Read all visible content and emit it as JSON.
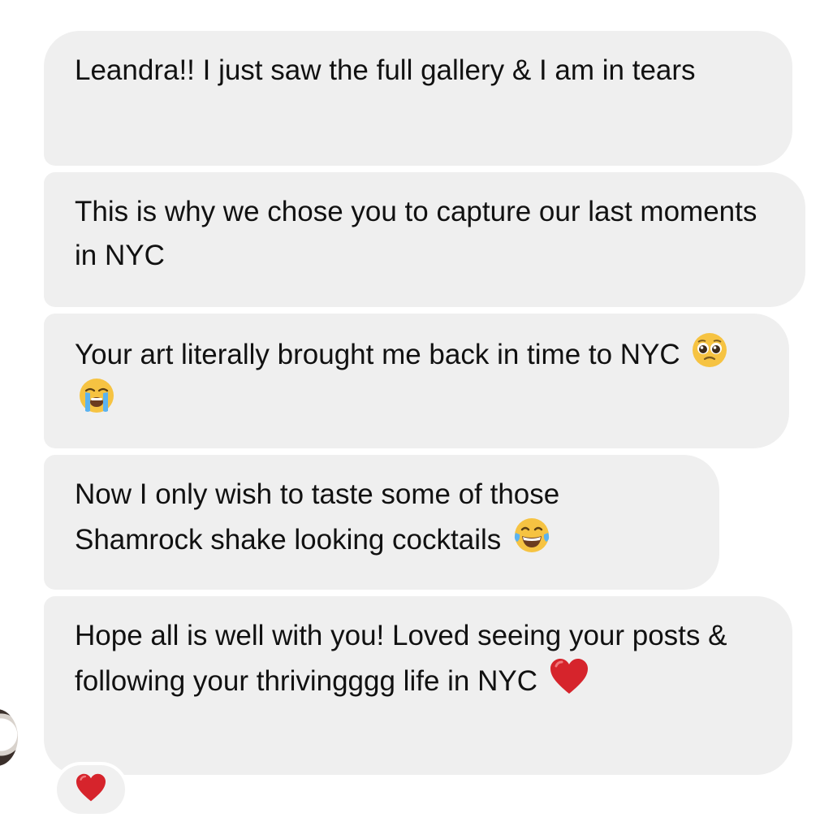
{
  "messages": [
    {
      "text": "Leandra!! I just saw the full gallery & I am in tears",
      "emojis": []
    },
    {
      "text": "This is why we chose you to capture our last moments in NYC",
      "emojis": []
    },
    {
      "text": "Your art literally brought me back in time to NYC",
      "emojis": [
        "pleading-face-icon",
        "loudly-crying-face-icon"
      ]
    },
    {
      "text": "Now I only wish to taste some of those Shamrock shake looking cocktails",
      "emojis": [
        "tears-of-joy-icon"
      ]
    },
    {
      "text": "Hope all is well with you! Loved seeing your posts & following your thrivingggg life in NYC",
      "emojis": [
        "red-heart-icon"
      ]
    }
  ],
  "reaction": {
    "emoji": "red-heart-icon"
  },
  "colors": {
    "bubble_bg": "#efefef",
    "text": "#111111",
    "heart": "#d6242c",
    "emoji_yellow": "#f6c342"
  }
}
